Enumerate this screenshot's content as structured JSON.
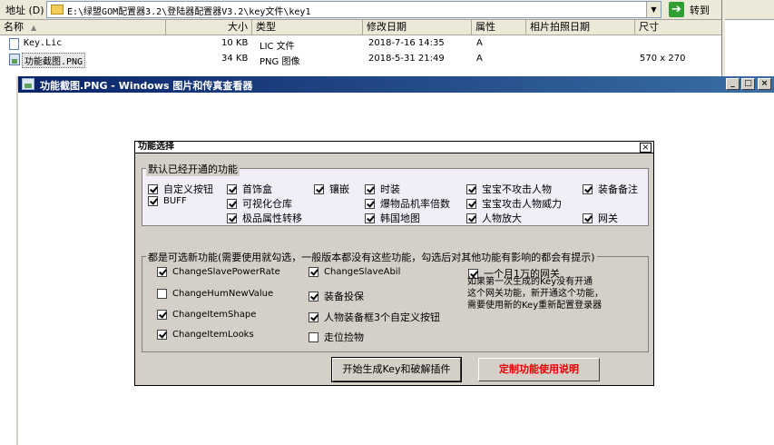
{
  "address_bar": {
    "label": "地址 (D)",
    "path": "E:\\绿盟GOM配置器3.2\\登陆器配置器V3.2\\key文件\\key1",
    "go_label": "转到"
  },
  "file_list": {
    "columns": [
      "名称",
      "大小",
      "类型",
      "修改日期",
      "属性",
      "相片拍照日期",
      "尺寸"
    ],
    "rows": [
      {
        "name": "Key.Lic",
        "size": "10 KB",
        "type": "LIC 文件",
        "modified": "2018-7-16 14:35",
        "attr": "A",
        "photo_date": "",
        "dims": ""
      },
      {
        "name": "功能截图.PNG",
        "size": "34 KB",
        "type": "PNG 图像",
        "modified": "2018-5-31 21:49",
        "attr": "A",
        "photo_date": "",
        "dims": "570 x 270"
      }
    ]
  },
  "viewer": {
    "title": "功能截图.PNG - Windows 图片和传真查看器",
    "btn_min": "_",
    "btn_max": "□",
    "btn_close": "×"
  },
  "dialog": {
    "title": "功能选择",
    "close": "×",
    "group1_label": "默认已经开通的功能",
    "group1_items": [
      {
        "label": "自定义按钮",
        "checked": true
      },
      {
        "label": "BUFF",
        "checked": true
      },
      {
        "label": "首饰盒",
        "checked": true
      },
      {
        "label": "可视化仓库",
        "checked": true
      },
      {
        "label": "极品属性转移",
        "checked": true
      },
      {
        "label": "镶嵌",
        "checked": true
      },
      {
        "label": "时装",
        "checked": true
      },
      {
        "label": "爆物品机率倍数",
        "checked": true
      },
      {
        "label": "韩国地图",
        "checked": true
      },
      {
        "label": "宝宝不攻击人物",
        "checked": true
      },
      {
        "label": "宝宝攻击人物威力",
        "checked": true
      },
      {
        "label": "人物放大",
        "checked": true
      },
      {
        "label": "装备备注",
        "checked": true
      },
      {
        "label": "网关",
        "checked": true
      }
    ],
    "group2_label": "都是可选新功能(需要使用就勾选，一般版本都没有这些功能，勾选后对其他功能有影响的都会有提示)",
    "group2_items": [
      {
        "label": "ChangeSlavePowerRate",
        "checked": true
      },
      {
        "label": "ChangeHumNewValue",
        "checked": false
      },
      {
        "label": "ChangeItemShape",
        "checked": true
      },
      {
        "label": "ChangeItemLooks",
        "checked": true
      },
      {
        "label": "ChangeSlaveAbil",
        "checked": true
      },
      {
        "label": "装备投保",
        "checked": true
      },
      {
        "label": "人物装备框3个自定义按钮",
        "checked": true
      },
      {
        "label": "走位捡物",
        "checked": false
      },
      {
        "label": "一个月1万的网关",
        "checked": true
      }
    ],
    "note_lines": [
      "如果第一次生成的Key没有开通",
      "这个网关功能，新开通这个功能，",
      "需要使用新的Key重新配置登录器"
    ],
    "generate_button": "开始生成Key和破解插件",
    "help_button": "定制功能使用说明"
  }
}
